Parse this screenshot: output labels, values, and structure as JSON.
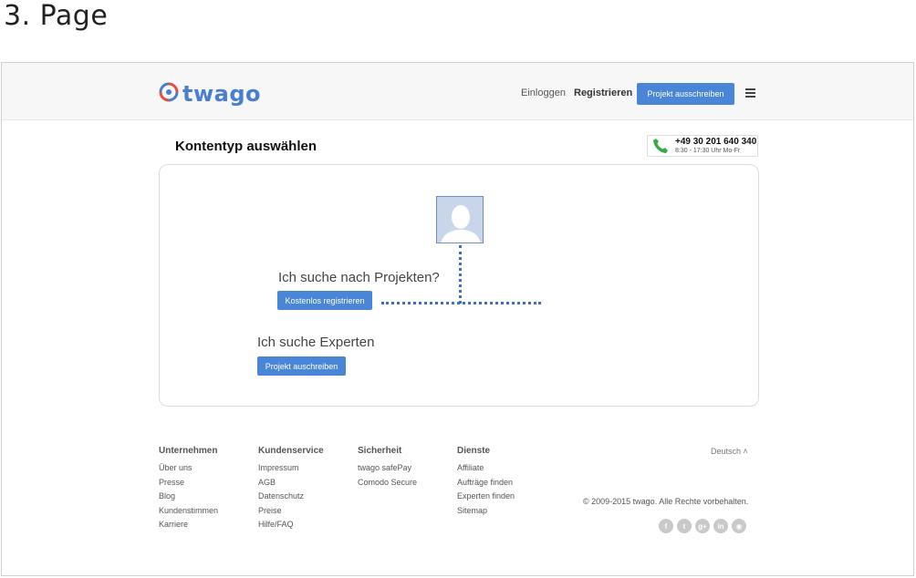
{
  "page_heading": "3. Page",
  "header": {
    "logo_text": "twago",
    "login_label": "Einloggen",
    "register_label": "Registrieren",
    "cta_label": "Projekt ausschreiben",
    "menu_icon": "hamburger-menu-icon"
  },
  "main": {
    "title": "Kontentyp auswählen",
    "phone": {
      "icon": "phone-icon",
      "number": "+49 30 201 640 340",
      "hours": "8:30 - 17:30 Uhr Mo-Fr"
    },
    "card": {
      "avatar_icon": "user-silhouette-icon",
      "project_question": "Ich suche nach Projekten?",
      "project_button": "Kostenlos registrieren",
      "expert_question": "Ich suche Experten",
      "expert_button": "Projekt auschreiben"
    }
  },
  "footer": {
    "columns": [
      {
        "heading": "Unternehmen",
        "links": [
          "Über uns",
          "Presse",
          "Blog",
          "Kundenstimmen",
          "Karriere"
        ]
      },
      {
        "heading": "Kundenservice",
        "links": [
          "Impressum",
          "AGB",
          "Datenschutz",
          "Preise",
          "Hilfe/FAQ"
        ]
      },
      {
        "heading": "Sicherheit",
        "links": [
          "twago safePay",
          "Comodo Secure"
        ]
      },
      {
        "heading": "Dienste",
        "links": [
          "Affiliate",
          "Aufträge finden",
          "Experten finden",
          "Sitemap"
        ]
      }
    ],
    "language": "Deutsch ˄",
    "copyright": "© 2009-2015 twago. Alle Rechte vorbehalten.",
    "social_icons": [
      {
        "name": "facebook-icon",
        "glyph": "f"
      },
      {
        "name": "twitter-icon",
        "glyph": "t"
      },
      {
        "name": "google-plus-icon",
        "glyph": "g+"
      },
      {
        "name": "linkedin-icon",
        "glyph": "in"
      },
      {
        "name": "rss-icon",
        "glyph": "◉"
      }
    ]
  },
  "colors": {
    "accent_blue": "#4a86d8",
    "logo_blue": "#4a7fcf",
    "logo_red": "#e84c3d",
    "phone_green": "#3aa843"
  }
}
